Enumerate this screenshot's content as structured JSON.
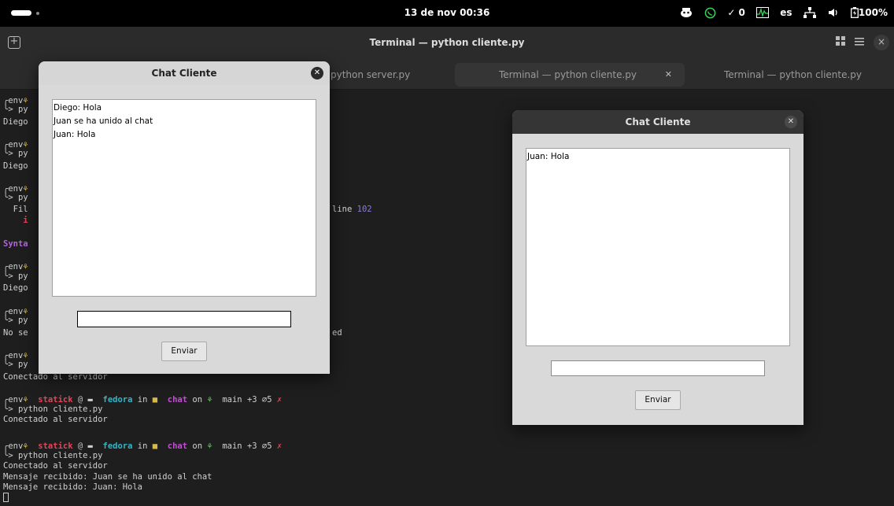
{
  "topbar": {
    "clock": "13 de nov  00:36",
    "tray": {
      "icon_a": "mascot-indicator-icon",
      "icon_b": "whatsapp-icon",
      "check_label": "✓ 0",
      "system_monitor_icon": "system-monitor-icon",
      "keyboard_layout": "es",
      "network_icon": "network-icon",
      "volume_icon": "volume-icon",
      "battery_label": "100%"
    }
  },
  "terminal": {
    "window_title": "Terminal — python cliente.py",
    "tabs": [
      {
        "label": "python server.py"
      },
      {
        "label": "Terminal — python cliente.py"
      },
      {
        "label": "Terminal — python cliente.py"
      }
    ],
    "left_fragments": [
      "╭env",
      "╰> py",
      "Diego",
      "╭env",
      "╰> py",
      "Diego",
      "╭env",
      "╰> py",
      "  Fil",
      "    i",
      "Synta",
      "╭env",
      "╰> py",
      "Diego",
      "╭env",
      "╰> py",
      "No se",
      "╭env",
      "╰> py"
    ],
    "right_fragments": {
      "line_text": "line",
      "line_number": "102",
      "ed_text": "ed"
    },
    "lines": {
      "connected_1": "Conectado al servidor",
      "prompt_env": "╭env",
      "user": "statick",
      "at": "@",
      "host": "fedora",
      "in": "in",
      "dir": "chat",
      "on": "on",
      "branch": "main",
      "status": "+3 ⌀5",
      "x_mark": "✗",
      "cmd": "╰> python cliente.py",
      "connected_2": "Conectado al servidor",
      "connected_3": "Conectado al servidor",
      "received_1": "Mensaje recibido: Juan se ha unido al chat",
      "received_2": "Mensaje recibido: Juan: Hola"
    }
  },
  "chat_windows": [
    {
      "title": "Chat Cliente",
      "messages": [
        "Diego: Hola",
        "Juan se ha unido al chat",
        "Juan: Hola"
      ],
      "input_value": "",
      "send_label": "Enviar"
    },
    {
      "title": "Chat Cliente",
      "messages": [
        "Juan: Hola"
      ],
      "input_value": "",
      "send_label": "Enviar"
    }
  ]
}
